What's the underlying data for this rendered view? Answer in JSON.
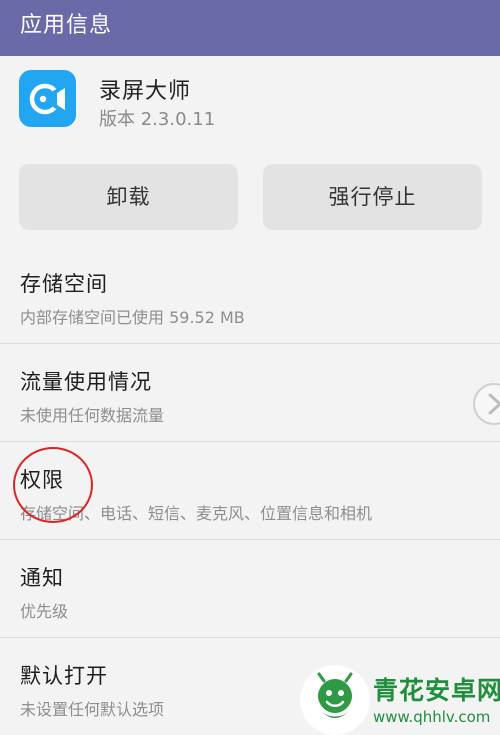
{
  "topbar": {
    "title": "应用信息",
    "background": "#6a6aa8"
  },
  "app": {
    "name": "录屏大师",
    "version": "版本 2.3.0.11",
    "icon": "screen-recorder-icon",
    "icon_color": "#23a6f2"
  },
  "actions": {
    "uninstall_label": "卸载",
    "force_stop_label": "强行停止"
  },
  "rows": [
    {
      "label": "存储空间",
      "sub": "内部存储空间已使用 59.52 MB"
    },
    {
      "label": "流量使用情况",
      "sub": "未使用任何数据流量"
    },
    {
      "label": "权限",
      "sub": "存储空间、电话、短信、麦克风、位置信息和相机"
    },
    {
      "label": "通知",
      "sub": "优先级"
    },
    {
      "label": "默认打开",
      "sub": "未设置任何默认选项"
    }
  ],
  "annotation": {
    "color": "#e02323",
    "icon": "red-circle-highlight"
  },
  "floating": {
    "icon": "chevron-right-icon"
  },
  "watermark": {
    "name": "青花安卓网",
    "url": "www.qhhlv.com",
    "color": "#1f8f3c",
    "icon": "qinghua-logo-icon"
  }
}
